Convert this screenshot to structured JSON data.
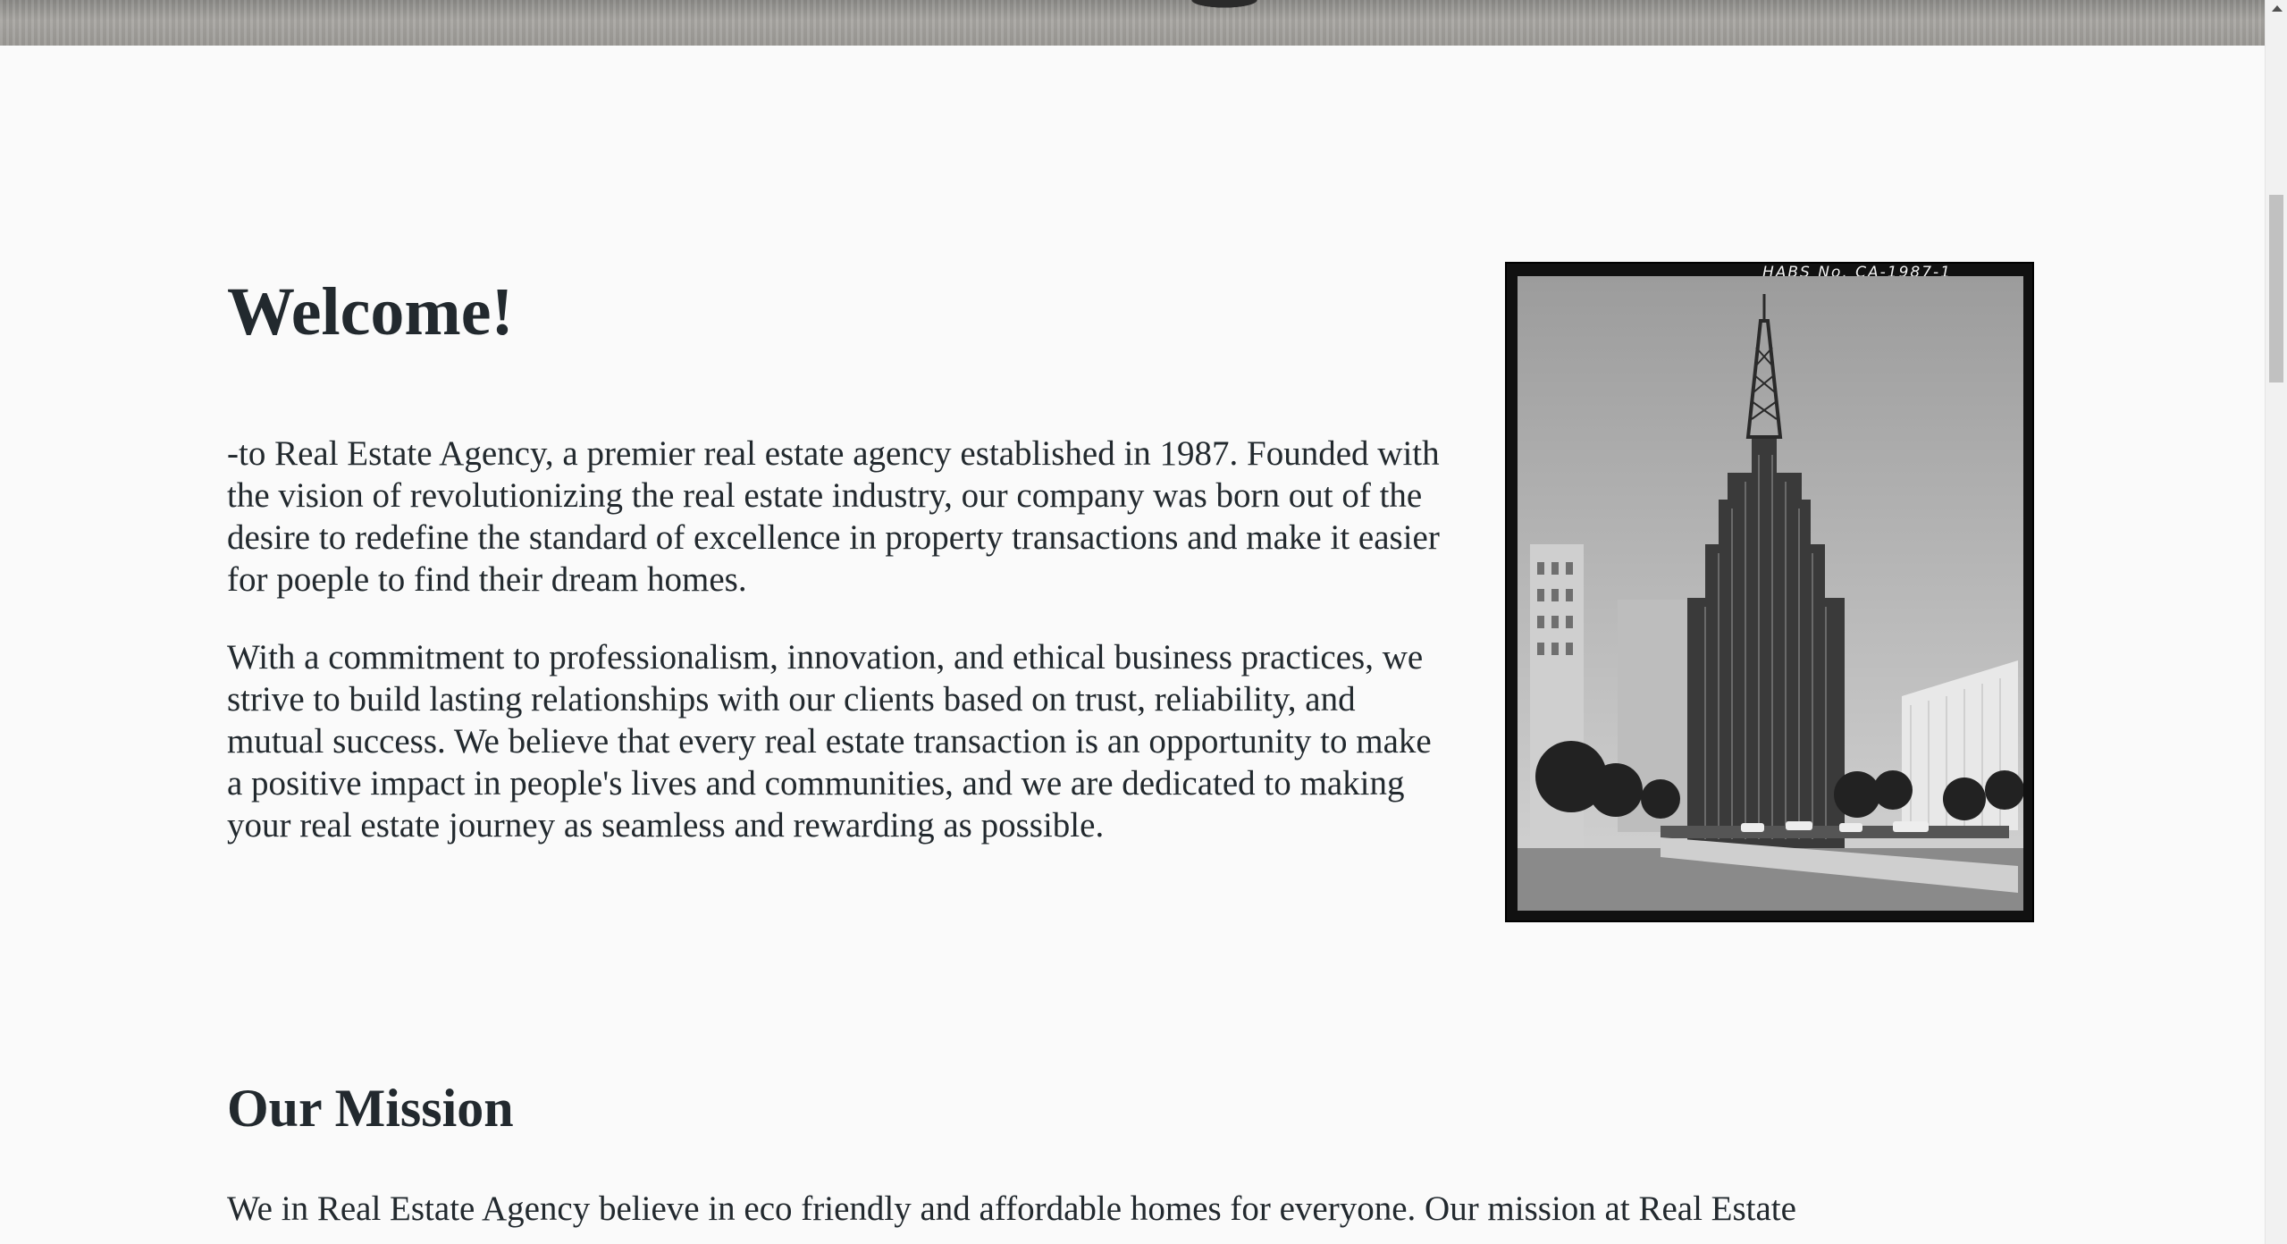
{
  "welcome": {
    "title": "Welcome!",
    "paragraphs": [
      "-to Real Estate Agency, a premier real estate agency established in 1987. Founded with the vision of revolutionizing the real estate industry, our company was born out of the desire to redefine the standard of excellence in property transactions and make it easier for poeple to find their dream homes.",
      "With a commitment to professionalism, innovation, and ethical business practices, we strive to build lasting relationships with our clients based on trust, reliability, and mutual success. We believe that every real estate transaction is an opportunity to make a positive impact in people's lives and communities, and we are dedicated to making your real estate journey as seamless and rewarding as possible."
    ],
    "photo_caption": "HABS No. CA-1987-1"
  },
  "mission": {
    "title": "Our Mission",
    "body": "We in Real Estate Agency believe in eco friendly and affordable homes for everyone. Our mission at Real Estate"
  },
  "colors": {
    "text": "#22292e",
    "background": "#fafafa"
  }
}
